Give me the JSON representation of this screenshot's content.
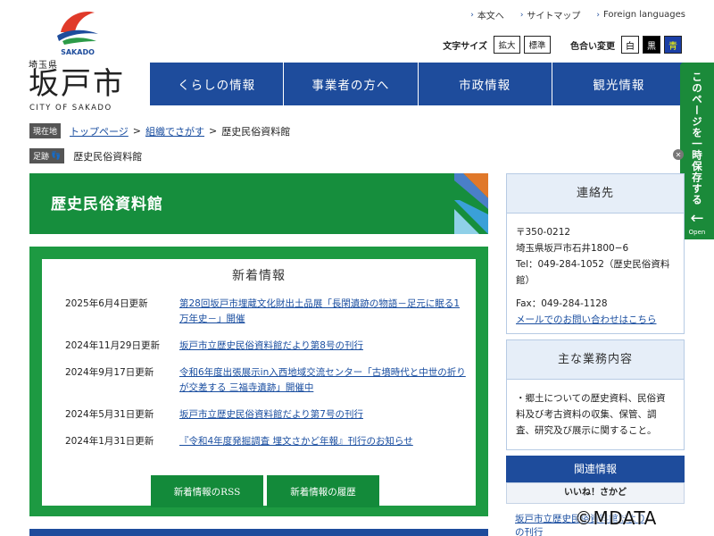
{
  "logo": {
    "sakado": "SAKADO",
    "pref": "埼玉県",
    "city": "坂戸市",
    "english": "CITY OF SAKADO"
  },
  "top_links": [
    {
      "label": "本文へ"
    },
    {
      "label": "サイトマップ"
    },
    {
      "label": "Foreign languages"
    }
  ],
  "font_size": {
    "label": "文字サイズ",
    "enlarge": "拡大",
    "standard": "標準"
  },
  "color_change": {
    "label": "色合い変更",
    "white": "白",
    "black": "黒",
    "blue": "青"
  },
  "nav": [
    {
      "label": "くらしの情報"
    },
    {
      "label": "事業者の方へ"
    },
    {
      "label": "市政情報"
    },
    {
      "label": "観光情報"
    }
  ],
  "save_tab": {
    "label": "このページを一時保存する",
    "open": "Open"
  },
  "breadcrumb": {
    "chip": "現在地",
    "items": [
      "トップページ",
      "組織でさがす",
      "歴史民俗資料館"
    ],
    "sep": ">"
  },
  "footprint": {
    "chip": "足跡",
    "item": "歴史民俗資料館"
  },
  "page_title": "歴史民俗資料館",
  "news": {
    "title": "新着情報",
    "items": [
      {
        "date": "2025年6月4日更新",
        "text": "第28回坂戸市埋蔵文化財出土品展「長閑遺跡の物語－足元に眠る1万年史－」開催"
      },
      {
        "date": "2024年11月29日更新",
        "text": "坂戸市立歴史民俗資料館だより第8号の刊行"
      },
      {
        "date": "2024年9月17日更新",
        "text": "令和6年度出張展示in入西地域交流センター「古墳時代と中世の折りが交差する 三福寺遺跡」開催中"
      },
      {
        "date": "2024年5月31日更新",
        "text": "坂戸市立歴史民俗資料館だより第7号の刊行"
      },
      {
        "date": "2024年1月31日更新",
        "text": "『令和4年度発掘調査 埋文さかど年報』刊行のお知らせ"
      }
    ],
    "rss_button": "新着情報のRSS",
    "history_button": "新着情報の履歴"
  },
  "contact": {
    "title": "連絡先",
    "postal": "〒350-0212",
    "address": "埼玉県坂戸市石井1800−6",
    "tel": "Tel：049-284-1052（歴史民俗資料館）",
    "fax": "Fax：049-284-1128",
    "mail_link": "メールでのお問い合わせはこちら"
  },
  "duties": {
    "title": "主な業務内容",
    "text": "・郷土についての歴史資料、民俗資料及び考古資料の収集、保管、調査、研究及び展示に関すること。"
  },
  "related": {
    "title": "関連情報",
    "subtitle": "いいね！さかど",
    "link": "坂戸市立歴史民俗資料館だよりの刊行"
  },
  "watermark": "©MDATA",
  "colors": {
    "nav_blue": "#1e4c9c",
    "green": "#168e3d",
    "link": "#1a4ea0"
  }
}
